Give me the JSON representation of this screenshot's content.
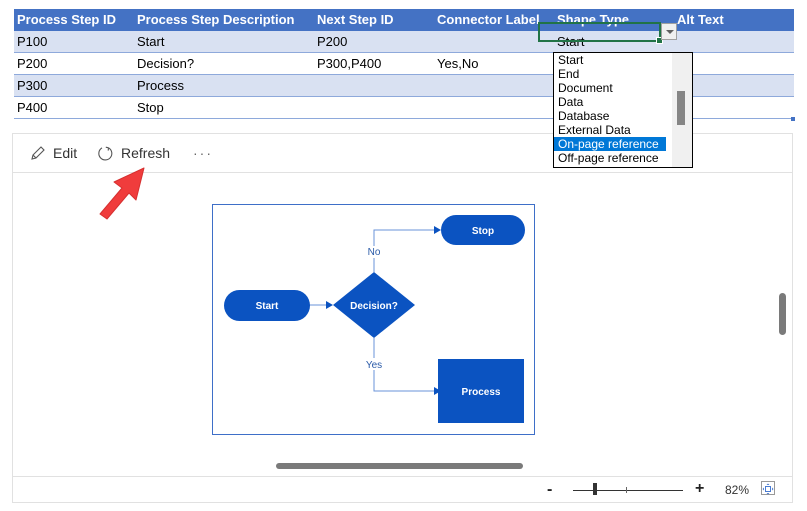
{
  "sheet": {
    "headers": [
      "Process Step ID",
      "Process Step Description",
      "Next Step ID",
      "Connector Label",
      "Shape Type",
      "Alt Text"
    ],
    "rows": [
      [
        "P100",
        "Start",
        "P200",
        "",
        "Start",
        ""
      ],
      [
        "P200",
        "Decision?",
        "P300,P400",
        "Yes,No",
        "",
        ""
      ],
      [
        "P300",
        "Process",
        "",
        "",
        "",
        ""
      ],
      [
        "P400",
        "Stop",
        "",
        "",
        "",
        ""
      ]
    ],
    "header_color": "#4472c4",
    "band_color": "#d9e1f2"
  },
  "dropdown": {
    "options": [
      "Start",
      "End",
      "Document",
      "Data",
      "Database",
      "External Data",
      "On-page reference",
      "Off-page reference"
    ],
    "highlighted": "On-page reference",
    "highlight_color": "#0078d7"
  },
  "toolbar": {
    "edit_label": "Edit",
    "refresh_label": "Refresh",
    "more_label": "···"
  },
  "diagram": {
    "shape_color": "#0b53c1",
    "shapes": {
      "start": "Start",
      "decision": "Decision?",
      "stop": "Stop",
      "process": "Process"
    },
    "connectors": {
      "no": "No",
      "yes": "Yes"
    }
  },
  "statusbar": {
    "zoom_minus": "-",
    "zoom_plus": "+",
    "zoom_percent": "82%",
    "zoom_value": 82
  },
  "annotation": {
    "arrow_color": "#f03c3c"
  }
}
